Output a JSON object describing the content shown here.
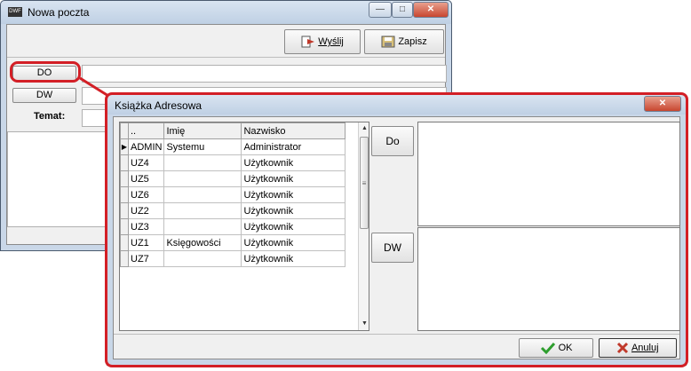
{
  "back_window": {
    "title": "Nowa poczta",
    "app_icon": "DWF",
    "minimize": "—",
    "maximize": "□",
    "close": "✕",
    "send_label": "Wyślij",
    "save_label": "Zapisz",
    "to_label": "DO",
    "cc_label": "DW",
    "subject_label": "Temat:"
  },
  "address_book": {
    "title": "Książka Adresowa",
    "close": "✕",
    "columns": [
      "..",
      "Imię",
      "Nazwisko"
    ],
    "rows": [
      {
        "id": "ADMIN",
        "first": "Systemu",
        "last": "Administrator"
      },
      {
        "id": "UZ4",
        "first": "",
        "last": "Użytkownik"
      },
      {
        "id": "UZ5",
        "first": "",
        "last": "Użytkownik"
      },
      {
        "id": "UZ6",
        "first": "",
        "last": "Użytkownik"
      },
      {
        "id": "UZ2",
        "first": "",
        "last": "Użytkownik"
      },
      {
        "id": "UZ3",
        "first": "",
        "last": "Użytkownik"
      },
      {
        "id": "UZ1",
        "first": "Księgowości",
        "last": "Użytkownik"
      },
      {
        "id": "UZ7",
        "first": "",
        "last": "Użytkownik"
      }
    ],
    "to_button": "Do",
    "cc_button": "DW",
    "ok_label": "OK",
    "cancel_label": "Anuluj"
  },
  "colors": {
    "highlight": "#d31f26",
    "ok_check": "#2e9e2e",
    "cancel_x": "#c0392b"
  }
}
